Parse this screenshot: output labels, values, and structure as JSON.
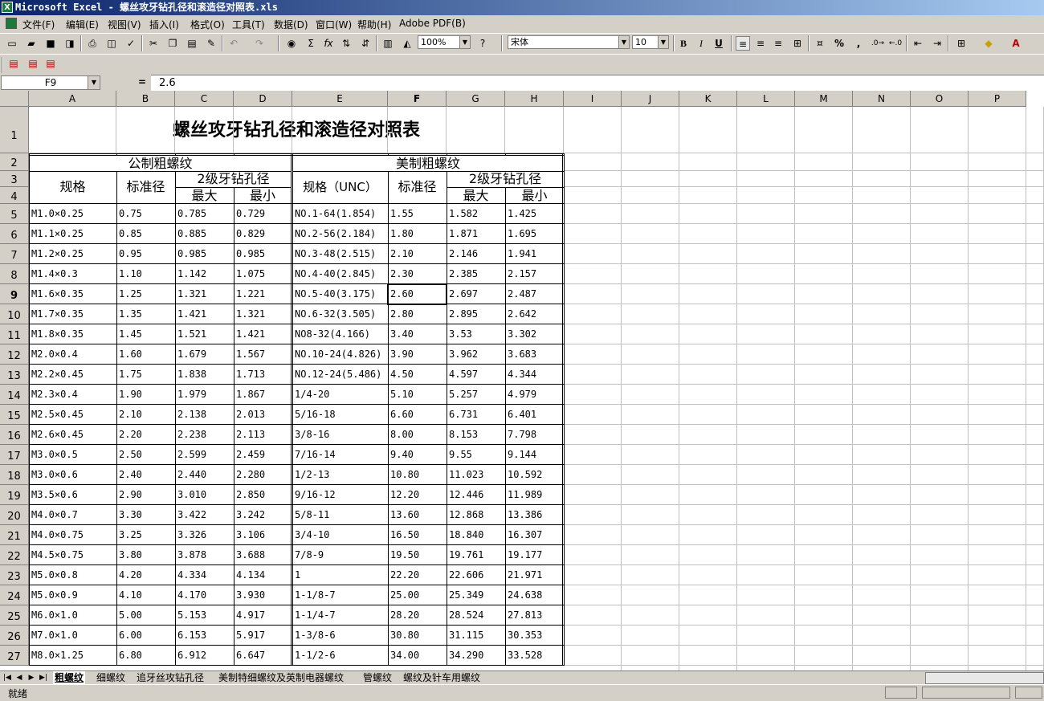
{
  "window": {
    "title": "Microsoft Excel - 螺丝攻牙钻孔径和滚造径对照表.xls",
    "app_icon_label": "X"
  },
  "menu": [
    "文件(F)",
    "编辑(E)",
    "视图(V)",
    "插入(I)",
    "格式(O)",
    "工具(T)",
    "数据(D)",
    "窗口(W)",
    "帮助(H)",
    "Adobe PDF(B)"
  ],
  "toolbar": {
    "zoom": "100%",
    "font": "宋体",
    "size": "10",
    "bold": "B",
    "italic": "I",
    "underline": "U",
    "percent": "%",
    "comma": ",",
    "sum": "Σ",
    "fx": "fx"
  },
  "formula": {
    "name_box": "F9",
    "equals": "=",
    "value": "2.6"
  },
  "columns": [
    "A",
    "B",
    "C",
    "D",
    "E",
    "F",
    "G",
    "H",
    "I",
    "J",
    "K",
    "L",
    "M",
    "N",
    "O",
    "P"
  ],
  "rows": [
    "1",
    "2",
    "3",
    "4",
    "5",
    "6",
    "7",
    "8",
    "9",
    "10",
    "11",
    "12",
    "13",
    "14",
    "15",
    "16",
    "17",
    "18",
    "19",
    "20",
    "21",
    "22",
    "23",
    "24",
    "25",
    "26",
    "27"
  ],
  "sheet": {
    "title": "螺丝攻牙钻孔径和滚造径对照表",
    "metric_header": "公制粗螺纹",
    "us_header": "美制粗螺纹",
    "spec": "规格",
    "std_dia": "标准径",
    "drill_header": "2级牙钻孔径",
    "max": "最大",
    "min": "最小",
    "spec_unc": "规格（UNC）",
    "data": [
      [
        "M1.0×0.25",
        "0.75",
        "0.785",
        "0.729",
        "NO.1-64(1.854)",
        "1.55",
        "1.582",
        "1.425"
      ],
      [
        "M1.1×0.25",
        "0.85",
        "0.885",
        "0.829",
        "NO.2-56(2.184)",
        "1.80",
        "1.871",
        "1.695"
      ],
      [
        "M1.2×0.25",
        "0.95",
        "0.985",
        "0.985",
        "NO.3-48(2.515)",
        "2.10",
        "2.146",
        "1.941"
      ],
      [
        "M1.4×0.3",
        "1.10",
        "1.142",
        "1.075",
        "NO.4-40(2.845)",
        "2.30",
        "2.385",
        "2.157"
      ],
      [
        "M1.6×0.35",
        "1.25",
        "1.321",
        "1.221",
        "NO.5-40(3.175)",
        "2.60",
        "2.697",
        "2.487"
      ],
      [
        "M1.7×0.35",
        "1.35",
        "1.421",
        "1.321",
        "NO.6-32(3.505)",
        "2.80",
        "2.895",
        "2.642"
      ],
      [
        "M1.8×0.35",
        "1.45",
        "1.521",
        "1.421",
        "NO8-32(4.166)",
        "3.40",
        "3.53",
        "3.302"
      ],
      [
        "M2.0×0.4",
        "1.60",
        "1.679",
        "1.567",
        "NO.10-24(4.826)",
        "3.90",
        "3.962",
        "3.683"
      ],
      [
        "M2.2×0.45",
        "1.75",
        "1.838",
        "1.713",
        "NO.12-24(5.486)",
        "4.50",
        "4.597",
        "4.344"
      ],
      [
        "M2.3×0.4",
        "1.90",
        "1.979",
        "1.867",
        "1/4-20",
        "5.10",
        "5.257",
        "4.979"
      ],
      [
        "M2.5×0.45",
        "2.10",
        "2.138",
        "2.013",
        "5/16-18",
        "6.60",
        "6.731",
        "6.401"
      ],
      [
        "M2.6×0.45",
        "2.20",
        "2.238",
        "2.113",
        "3/8-16",
        "8.00",
        "8.153",
        "7.798"
      ],
      [
        "M3.0×0.5",
        "2.50",
        "2.599",
        "2.459",
        "7/16-14",
        "9.40",
        "9.55",
        "9.144"
      ],
      [
        "M3.0×0.6",
        "2.40",
        "2.440",
        "2.280",
        "1/2-13",
        "10.80",
        "11.023",
        "10.592"
      ],
      [
        "M3.5×0.6",
        "2.90",
        "3.010",
        "2.850",
        "9/16-12",
        "12.20",
        "12.446",
        "11.989"
      ],
      [
        "M4.0×0.7",
        "3.30",
        "3.422",
        "3.242",
        "5/8-11",
        "13.60",
        "12.868",
        "13.386"
      ],
      [
        "M4.0×0.75",
        "3.25",
        "3.326",
        "3.106",
        "3/4-10",
        "16.50",
        "18.840",
        "16.307"
      ],
      [
        "M4.5×0.75",
        "3.80",
        "3.878",
        "3.688",
        "7/8-9",
        "19.50",
        "19.761",
        "19.177"
      ],
      [
        "M5.0×0.8",
        "4.20",
        "4.334",
        "4.134",
        "1",
        "22.20",
        "22.606",
        "21.971"
      ],
      [
        "M5.0×0.9",
        "4.10",
        "4.170",
        "3.930",
        "1-1/8-7",
        "25.00",
        "25.349",
        "24.638"
      ],
      [
        "M6.0×1.0",
        "5.00",
        "5.153",
        "4.917",
        "1-1/4-7",
        "28.20",
        "28.524",
        "27.813"
      ],
      [
        "M7.0×1.0",
        "6.00",
        "6.153",
        "5.917",
        "1-3/8-6",
        "30.80",
        "31.115",
        "30.353"
      ],
      [
        "M8.0×1.25",
        "6.80",
        "6.912",
        "6.647",
        "1-1/2-6",
        "34.00",
        "34.290",
        "33.528"
      ]
    ]
  },
  "tabs": [
    "粗螺纹",
    "细螺纹",
    "追牙丝攻钻孔径",
    "美制特细螺纹及英制电器螺纹",
    "管螺纹",
    "螺纹及针车用螺纹"
  ],
  "status": "就绪"
}
